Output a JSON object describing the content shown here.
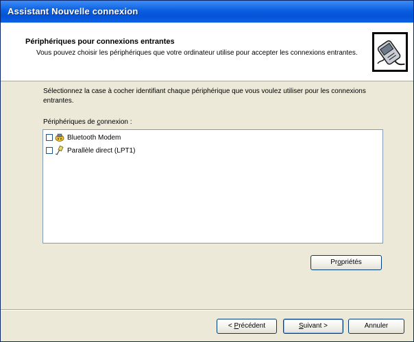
{
  "window": {
    "title": "Assistant Nouvelle connexion"
  },
  "header": {
    "title": "Périphériques pour connexions entrantes",
    "subtitle": "Vous pouvez choisir les périphériques que votre ordinateur utilise pour accepter les connexions entrantes.",
    "icon": "phone-connector-icon"
  },
  "main": {
    "instructions": "Sélectionnez la case à cocher identifiant chaque périphérique que vous voulez utiliser pour les connexions entrantes.",
    "list_label_before": "Périphériques de ",
    "list_label_accel": "c",
    "list_label_after": "onnexion :",
    "devices": [
      {
        "label": "Bluetooth Modem",
        "checked": false,
        "icon": "modem-icon"
      },
      {
        "label": "Parallèle direct (LPT1)",
        "checked": false,
        "icon": "cable-icon"
      }
    ],
    "properties_before": "Pr",
    "properties_accel": "o",
    "properties_after": "priétés"
  },
  "footer": {
    "back_before": "< ",
    "back_accel": "P",
    "back_after": "récédent",
    "next_accel": "S",
    "next_after": "uivant >",
    "cancel_label": "Annuler"
  },
  "colors": {
    "titlebar": "#0a5fe0",
    "dialog_bg": "#ece9d8",
    "list_border": "#7f9db9"
  }
}
